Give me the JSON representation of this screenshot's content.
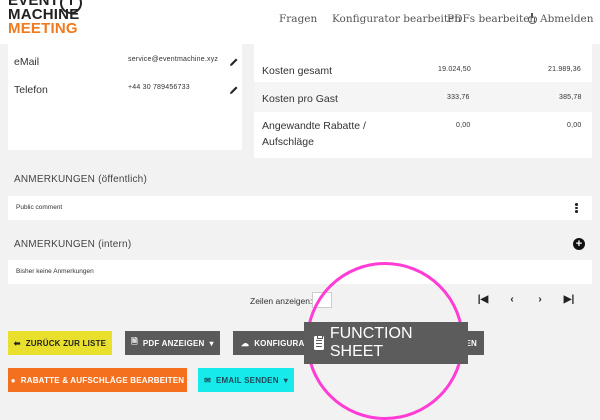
{
  "header": {
    "logo": {
      "line1": "EVENT",
      "line2": "MACHINE",
      "line3": "MEETING"
    },
    "nav": {
      "fragen": "Fragen",
      "konfigurator": "Konfigurator bearbeiten",
      "pdfs": "PDFs bearbeiten",
      "abmelden": "Abmelden"
    }
  },
  "contact": {
    "email_label": "eMail",
    "email_value": "service@eventmachine.xyz",
    "phone_label": "Telefon",
    "phone_value": "+44 30 789456733"
  },
  "costs": {
    "rows": [
      {
        "label": "Kosten gesamt",
        "col1": "19.024,50",
        "col2": "21.989,36"
      },
      {
        "label": "Kosten pro Gast",
        "col1": "333,76",
        "col2": "385,78"
      },
      {
        "label": "Angewandte Rabatte /",
        "label2": "Aufschläge",
        "col1": "0,00",
        "col2": "0,00"
      }
    ]
  },
  "remarks_public": {
    "title": "ANMERKUNGEN (öffentlich)",
    "text": "Public comment"
  },
  "remarks_internal": {
    "title": "ANMERKUNGEN (intern)",
    "text": "Bisher keine Anmerkungen"
  },
  "pager": {
    "label": "Zeilen anzeigen:"
  },
  "buttons": {
    "back": "ZURÜCK ZUR LISTE",
    "pdf": "PDF ANZEIGEN",
    "konfigurator": "KONFIGURATOR",
    "function_sheet_tail": "EN",
    "rabatte": "RABATTE & AUFSCHLÄGE BEARBEITEN",
    "email": "EMAIL SENDEN"
  },
  "magnifier": {
    "label": "FUNCTION SHEET"
  },
  "colors": {
    "accent_orange": "#f4701f",
    "yellow": "#e8e02c",
    "cyan": "#16eaea",
    "magnifier_ring": "#ff3cd5"
  }
}
